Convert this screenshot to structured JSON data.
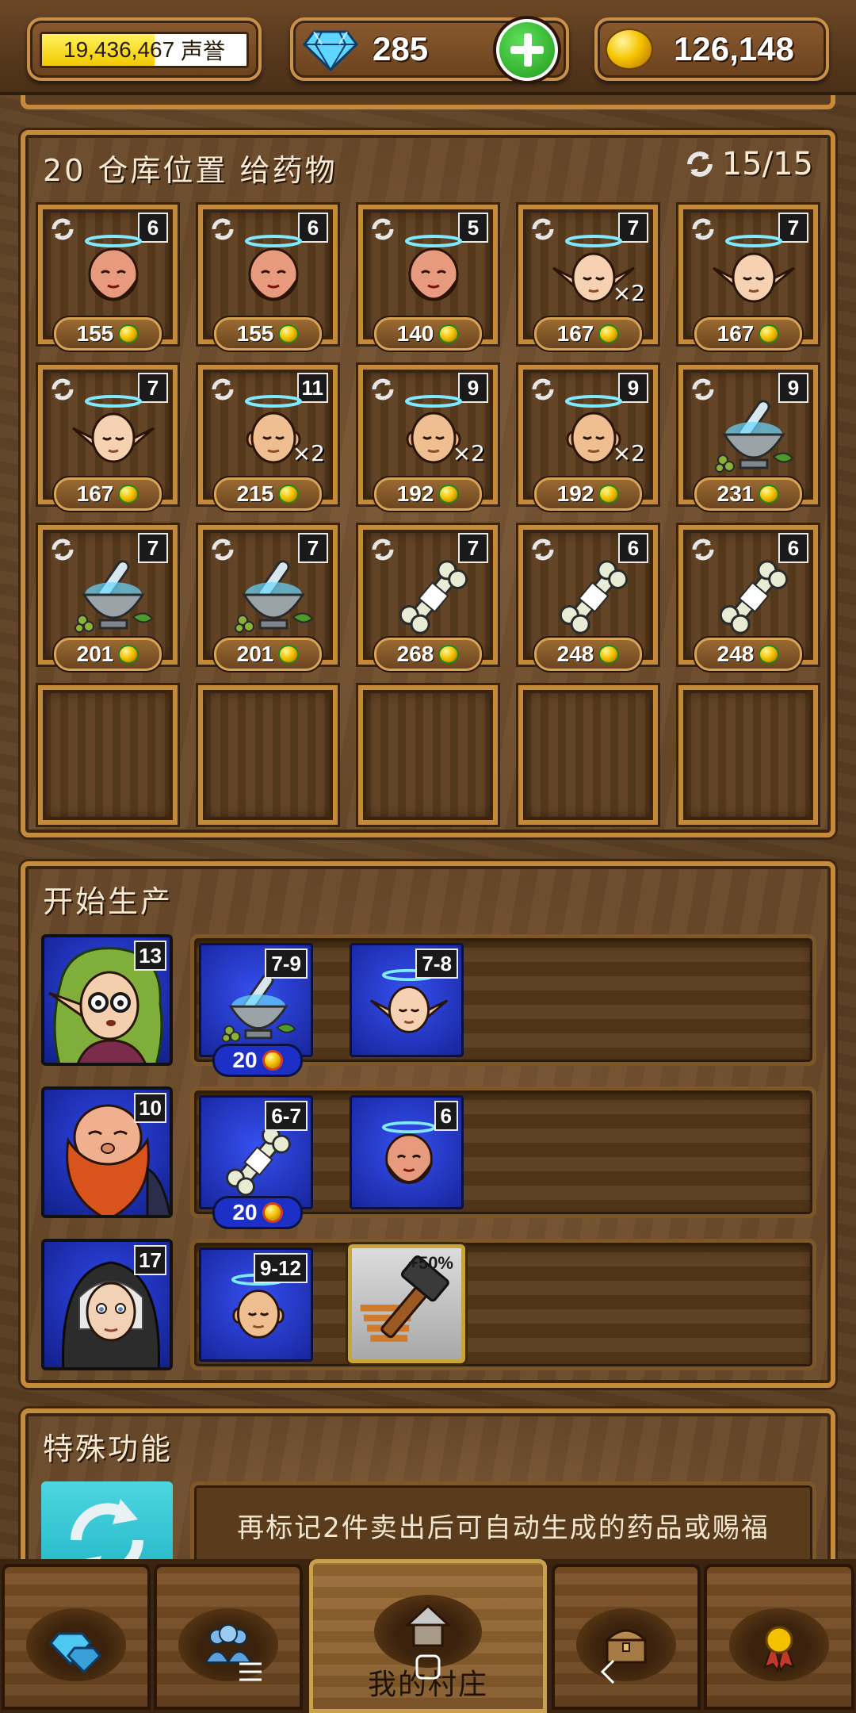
{
  "header": {
    "prestige": {
      "value": "19,436,467",
      "label": "声誉",
      "progress": 0.55
    },
    "gems": {
      "value": "285",
      "icon": "diamond-icon"
    },
    "gold": {
      "value": "126,148",
      "icon": "gold-coin-icon"
    },
    "add_button_icon": "plus-icon"
  },
  "storage": {
    "title": "20 仓库位置 给药物",
    "capacity": "15/15",
    "slots": [
      {
        "item": "dwarf-head",
        "level": "6",
        "price": "155",
        "multiplier": ""
      },
      {
        "item": "dwarf-head",
        "level": "6",
        "price": "155",
        "multiplier": ""
      },
      {
        "item": "dwarf-head",
        "level": "5",
        "price": "140",
        "multiplier": ""
      },
      {
        "item": "elf-head",
        "level": "7",
        "price": "167",
        "multiplier": "×2"
      },
      {
        "item": "elf-head",
        "level": "7",
        "price": "167",
        "multiplier": ""
      },
      {
        "item": "elf-head",
        "level": "7",
        "price": "167",
        "multiplier": ""
      },
      {
        "item": "human-head",
        "level": "11",
        "price": "215",
        "multiplier": "×2"
      },
      {
        "item": "human-head",
        "level": "9",
        "price": "192",
        "multiplier": "×2"
      },
      {
        "item": "human-head",
        "level": "9",
        "price": "192",
        "multiplier": "×2"
      },
      {
        "item": "mortar-herbs",
        "level": "9",
        "price": "231",
        "multiplier": ""
      },
      {
        "item": "mortar-herbs",
        "level": "7",
        "price": "201",
        "multiplier": ""
      },
      {
        "item": "mortar-herbs",
        "level": "7",
        "price": "201",
        "multiplier": ""
      },
      {
        "item": "bone",
        "level": "7",
        "price": "268",
        "multiplier": ""
      },
      {
        "item": "bone",
        "level": "6",
        "price": "248",
        "multiplier": ""
      },
      {
        "item": "bone",
        "level": "6",
        "price": "248",
        "multiplier": ""
      }
    ],
    "empty_slots": 5
  },
  "production": {
    "title": "开始生产",
    "rows": [
      {
        "worker": "elf-alchemist",
        "worker_level": "13",
        "recipes": [
          {
            "item": "mortar-herbs",
            "range": "7-9",
            "cost": "20"
          },
          {
            "item": "elf-head",
            "range": "7-8",
            "cost": ""
          }
        ]
      },
      {
        "worker": "dwarf-smith",
        "worker_level": "10",
        "recipes": [
          {
            "item": "bone",
            "range": "6-7",
            "cost": "20"
          },
          {
            "item": "dwarf-head",
            "range": "6",
            "cost": ""
          }
        ]
      },
      {
        "worker": "nun-healer",
        "worker_level": "17",
        "recipes": [
          {
            "item": "human-head",
            "range": "9-12",
            "cost": ""
          }
        ],
        "boost": {
          "label": "+50%",
          "icon": "hammer-icon"
        }
      }
    ]
  },
  "special": {
    "title": "特殊功能",
    "text": "再标记2件卖出后可自动生成的药品或赐福",
    "icon": "auto-refresh-icon"
  },
  "nav": {
    "tabs": [
      {
        "icon": "gem-shop-icon",
        "label": ""
      },
      {
        "icon": "people-icon",
        "label": ""
      },
      {
        "icon": "house-icon",
        "label": "我的村庄",
        "active": true
      },
      {
        "icon": "chest-icon",
        "label": ""
      },
      {
        "icon": "medal-icon",
        "label": ""
      }
    ],
    "system": [
      "menu-icon",
      "home-icon",
      "back-icon"
    ]
  },
  "colors": {
    "panel_border": "#c68b3a",
    "wood_dark": "#3d2611",
    "worker_blue": "#1c2fc7",
    "special_cyan": "#1eb2c4",
    "prestige_yellow": "#f2c900"
  }
}
